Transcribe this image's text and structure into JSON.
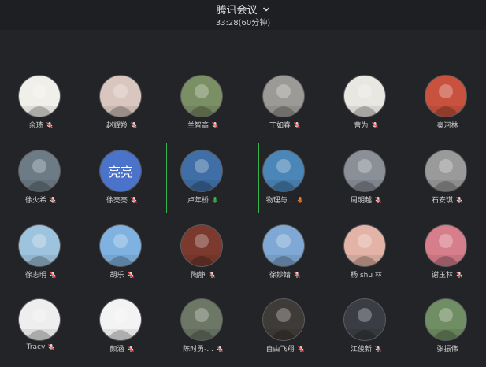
{
  "header": {
    "title": "腾讯会议",
    "duration": "33:28(60分钟)"
  },
  "participants": [
    {
      "name": "余琦",
      "avatar_text": "",
      "avatar_bg": "#f0efe9",
      "mic_state": "muted"
    },
    {
      "name": "赵耀羚",
      "avatar_text": "",
      "avatar_bg": "#d9c7bf",
      "mic_state": "muted"
    },
    {
      "name": "兰智高",
      "avatar_text": "",
      "avatar_bg": "#7b8f64",
      "mic_state": "muted"
    },
    {
      "name": "丁如春",
      "avatar_text": "",
      "avatar_bg": "#9c9a96",
      "mic_state": "muted"
    },
    {
      "name": "曹为",
      "avatar_text": "",
      "avatar_bg": "#e9e7e2",
      "mic_state": "muted"
    },
    {
      "name": "秦河林",
      "avatar_text": "",
      "avatar_bg": "#c9523e",
      "mic_state": "none"
    },
    {
      "name": "徐火希",
      "avatar_text": "",
      "avatar_bg": "#6d7b86",
      "mic_state": "muted"
    },
    {
      "name": "徐亮亮",
      "avatar_text": "亮亮",
      "avatar_bg": "#4a73c9",
      "mic_state": "muted"
    },
    {
      "name": "卢年桥",
      "avatar_text": "",
      "avatar_bg": "#3f6fa6",
      "mic_state": "speaking"
    },
    {
      "name": "物理与...",
      "avatar_text": "",
      "avatar_bg": "#4a86b7",
      "mic_state": "orange"
    },
    {
      "name": "周明越",
      "avatar_text": "",
      "avatar_bg": "#8a8f98",
      "mic_state": "muted"
    },
    {
      "name": "石安琪",
      "avatar_text": "",
      "avatar_bg": "#9a9a9a",
      "mic_state": "muted"
    },
    {
      "name": "徐志明",
      "avatar_text": "",
      "avatar_bg": "#9ec3de",
      "mic_state": "muted"
    },
    {
      "name": "胡乐",
      "avatar_text": "",
      "avatar_bg": "#7fb2e0",
      "mic_state": "muted"
    },
    {
      "name": "陶静",
      "avatar_text": "",
      "avatar_bg": "#7b3a2d",
      "mic_state": "muted"
    },
    {
      "name": "徐妙婧",
      "avatar_text": "",
      "avatar_bg": "#7fa9d4",
      "mic_state": "muted"
    },
    {
      "name": "杨 shu 林",
      "avatar_text": "",
      "avatar_bg": "#e2b3a6",
      "mic_state": "none"
    },
    {
      "name": "谢玉林",
      "avatar_text": "",
      "avatar_bg": "#d67e8b",
      "mic_state": "muted"
    },
    {
      "name": "Tracy",
      "avatar_text": "",
      "avatar_bg": "#eeeeee",
      "mic_state": "muted"
    },
    {
      "name": "颜涵",
      "avatar_text": "",
      "avatar_bg": "#f3f3f3",
      "mic_state": "muted"
    },
    {
      "name": "陈时勇-...",
      "avatar_text": "",
      "avatar_bg": "#6c7766",
      "mic_state": "muted"
    },
    {
      "name": "自由飞翔",
      "avatar_text": "",
      "avatar_bg": "#3f3b38",
      "mic_state": "muted"
    },
    {
      "name": "江俊新",
      "avatar_text": "",
      "avatar_bg": "#3a3d43",
      "mic_state": "muted"
    },
    {
      "name": "张振伟",
      "avatar_text": "",
      "avatar_bg": "#6f8e63",
      "mic_state": "none"
    }
  ],
  "colors": {
    "background": "#232427",
    "active_border": "#36b34a",
    "mic_muted": "#d9d9d9",
    "mic_muted_slash": "#ff5b5b",
    "mic_speaking": "#36b34a",
    "mic_orange": "#e37a33"
  }
}
